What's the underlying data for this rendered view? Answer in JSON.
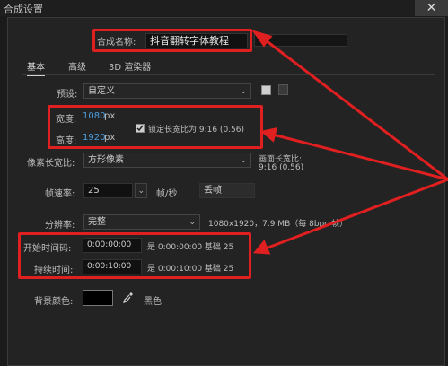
{
  "window": {
    "title": "合成设置",
    "close_glyph": "✕"
  },
  "comp_name": {
    "label": "合成名称:",
    "value": "抖音翻转字体教程"
  },
  "tabs": [
    {
      "label": "基本",
      "active": true
    },
    {
      "label": "高级",
      "active": false
    },
    {
      "label": "3D 渲染器",
      "active": false
    }
  ],
  "preset": {
    "label": "预设:",
    "value": "自定义"
  },
  "dimensions": {
    "width_label": "宽度:",
    "width_value": "1080",
    "width_unit": "px",
    "height_label": "高度:",
    "height_value": "1920",
    "height_unit": "px",
    "lock_label": "锁定长宽比为 9:16 (0.56)",
    "lock_checked": true
  },
  "pixel_aspect": {
    "label": "像素长宽比:",
    "value": "方形像素",
    "frame_aspect_label": "画面长宽比:",
    "frame_aspect_value": "9:16 (0.56)"
  },
  "frame_rate": {
    "label": "帧速率:",
    "value": "25",
    "unit": "帧/秒",
    "drop_frame": "丢帧"
  },
  "resolution": {
    "label": "分辨率:",
    "value": "完整",
    "info": "1080x1920，7.9 MB（每 8bpc 帧）"
  },
  "timecode": {
    "start_label": "开始时间码:",
    "start_value": "0:00:00:00",
    "start_info": "是 0:00:00:00  基础 25",
    "duration_label": "持续时间:",
    "duration_value": "0:00:10:00",
    "duration_info": "是 0:00:10:00  基础 25"
  },
  "background": {
    "label": "背景颜色:",
    "color": "#000000",
    "color_name": "黑色"
  },
  "colors": {
    "annotation_red": "#e02020",
    "value_blue": "#4a9ee0"
  },
  "icons": [
    "close-icon",
    "chevron-down-icon",
    "save-preset-icon",
    "delete-preset-icon",
    "eyedropper-icon",
    "checkmark-icon"
  ]
}
